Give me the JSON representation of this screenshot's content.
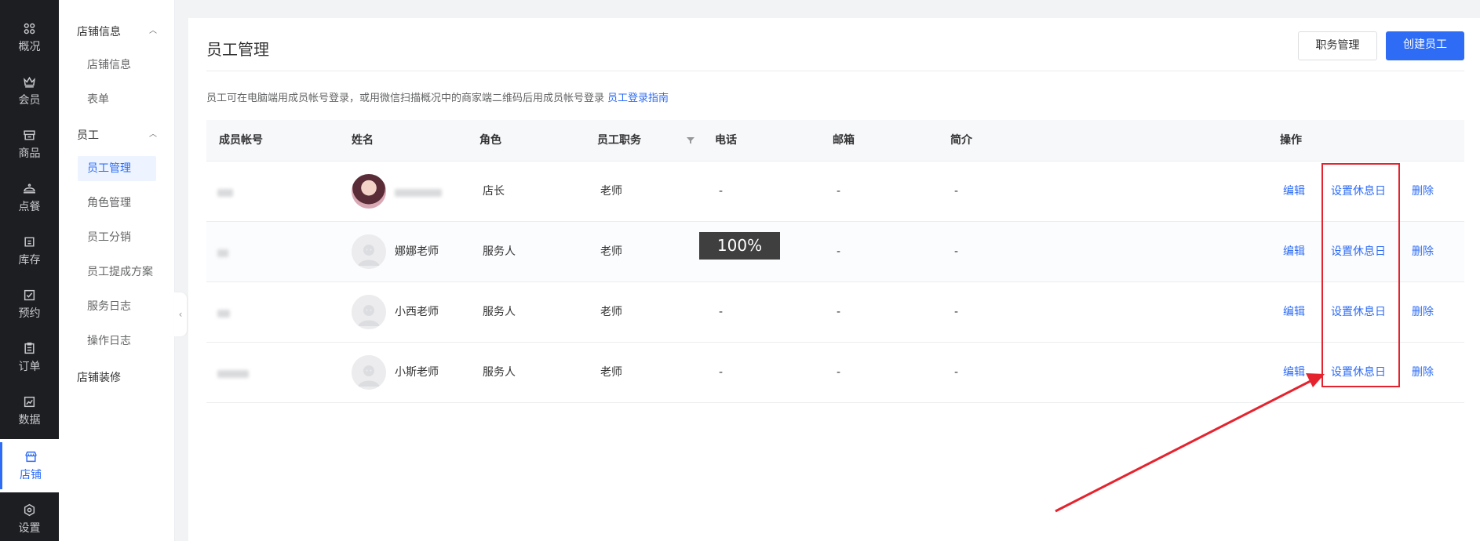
{
  "rail": {
    "items": [
      {
        "label": "概况",
        "icon": "dashboard-icon"
      },
      {
        "label": "会员",
        "icon": "crown-icon"
      },
      {
        "label": "商品",
        "icon": "box-icon"
      },
      {
        "label": "点餐",
        "icon": "food-cover-icon"
      },
      {
        "label": "库存",
        "icon": "inventory-icon"
      },
      {
        "label": "预约",
        "icon": "checkbox-icon"
      },
      {
        "label": "订单",
        "icon": "order-icon"
      },
      {
        "label": "数据",
        "icon": "chart-icon"
      },
      {
        "label": "店铺",
        "icon": "store-icon"
      },
      {
        "label": "设置",
        "icon": "gear-icon"
      }
    ],
    "active_index": 8
  },
  "submenu": {
    "group_store": "店铺信息",
    "store_items": [
      "店铺信息",
      "表单"
    ],
    "group_staff": "员工",
    "staff_items": [
      "员工管理",
      "角色管理",
      "员工分销",
      "员工提成方案",
      "服务日志",
      "操作日志"
    ],
    "group_decor": "店铺装修",
    "active": "员工管理"
  },
  "page": {
    "title": "员工管理",
    "btn_position": "职务管理",
    "btn_create": "创建员工",
    "tip": "员工可在电脑端用成员帐号登录，或用微信扫描概况中的商家端二维码后用成员帐号登录",
    "tip_link": "员工登录指南"
  },
  "table": {
    "headers": [
      "成员帐号",
      "姓名",
      "角色",
      "员工职务",
      "电话",
      "邮箱",
      "简介",
      "操作"
    ],
    "rows": [
      {
        "name": "",
        "role": "店长",
        "title": "老师",
        "phone": "-",
        "email": "-",
        "intro": "-"
      },
      {
        "name": "娜娜老师",
        "role": "服务人",
        "title": "老师",
        "phone": "",
        "email": "-",
        "intro": "-"
      },
      {
        "name": "小西老师",
        "role": "服务人",
        "title": "老师",
        "phone": "-",
        "email": "-",
        "intro": "-"
      },
      {
        "name": "小斯老师",
        "role": "服务人",
        "title": "老师",
        "phone": "-",
        "email": "-",
        "intro": "-"
      }
    ],
    "actions": {
      "edit": "编辑",
      "rest": "设置休息日",
      "delete": "删除"
    }
  },
  "overlay": {
    "percent": "100%"
  },
  "colors": {
    "primary": "#2e6cf6",
    "annotation": "#e5232e",
    "rail_bg": "#1c1e22"
  }
}
